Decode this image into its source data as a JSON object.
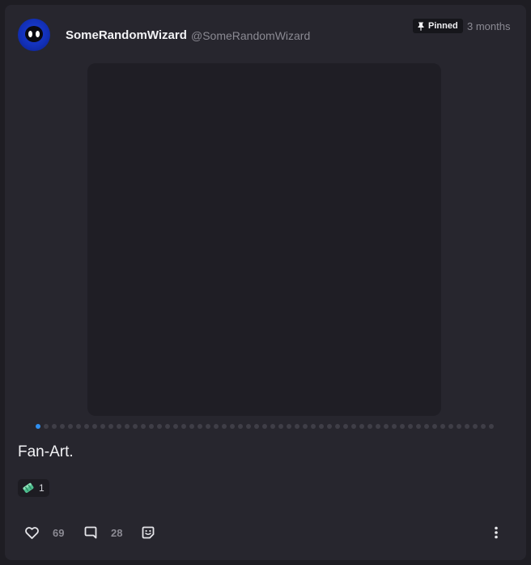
{
  "post": {
    "author": {
      "display_name": "SomeRandomWizard",
      "handle": "@SomeRandomWizard"
    },
    "pinned_label": "Pinned",
    "time": "3 months",
    "carousel": {
      "total_slides": 57,
      "active_index": 0,
      "active_color": "#2f8ff0"
    },
    "caption": "Fan-Art.",
    "reaction": {
      "icon": "gem-icon",
      "count": "1"
    },
    "actions": {
      "likes": "69",
      "comments": "28",
      "sticker_icon": "sticker-icon",
      "more_icon": "more-vertical-icon"
    }
  },
  "colors": {
    "card_bg": "#27262e",
    "page_bg": "#1e1d23",
    "accent": "#2f8ff0"
  }
}
